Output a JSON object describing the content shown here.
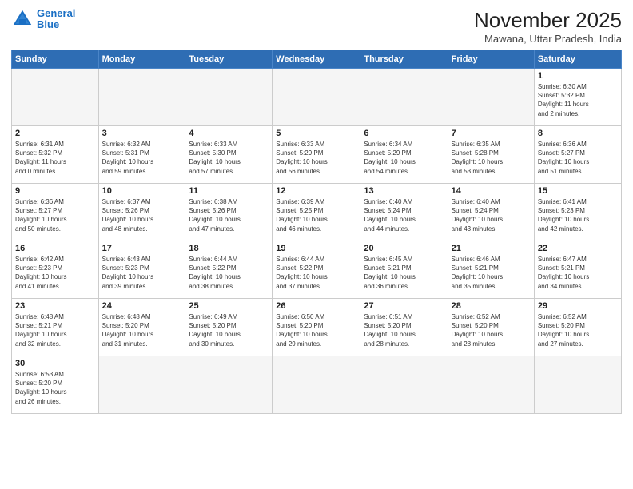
{
  "logo": {
    "line1": "General",
    "line2": "Blue"
  },
  "title": "November 2025",
  "subtitle": "Mawana, Uttar Pradesh, India",
  "weekdays": [
    "Sunday",
    "Monday",
    "Tuesday",
    "Wednesday",
    "Thursday",
    "Friday",
    "Saturday"
  ],
  "weeks": [
    [
      {
        "day": "",
        "info": ""
      },
      {
        "day": "",
        "info": ""
      },
      {
        "day": "",
        "info": ""
      },
      {
        "day": "",
        "info": ""
      },
      {
        "day": "",
        "info": ""
      },
      {
        "day": "",
        "info": ""
      },
      {
        "day": "1",
        "info": "Sunrise: 6:30 AM\nSunset: 5:32 PM\nDaylight: 11 hours\nand 2 minutes."
      }
    ],
    [
      {
        "day": "2",
        "info": "Sunrise: 6:31 AM\nSunset: 5:32 PM\nDaylight: 11 hours\nand 0 minutes."
      },
      {
        "day": "3",
        "info": "Sunrise: 6:32 AM\nSunset: 5:31 PM\nDaylight: 10 hours\nand 59 minutes."
      },
      {
        "day": "4",
        "info": "Sunrise: 6:33 AM\nSunset: 5:30 PM\nDaylight: 10 hours\nand 57 minutes."
      },
      {
        "day": "5",
        "info": "Sunrise: 6:33 AM\nSunset: 5:29 PM\nDaylight: 10 hours\nand 56 minutes."
      },
      {
        "day": "6",
        "info": "Sunrise: 6:34 AM\nSunset: 5:29 PM\nDaylight: 10 hours\nand 54 minutes."
      },
      {
        "day": "7",
        "info": "Sunrise: 6:35 AM\nSunset: 5:28 PM\nDaylight: 10 hours\nand 53 minutes."
      },
      {
        "day": "8",
        "info": "Sunrise: 6:36 AM\nSunset: 5:27 PM\nDaylight: 10 hours\nand 51 minutes."
      }
    ],
    [
      {
        "day": "9",
        "info": "Sunrise: 6:36 AM\nSunset: 5:27 PM\nDaylight: 10 hours\nand 50 minutes."
      },
      {
        "day": "10",
        "info": "Sunrise: 6:37 AM\nSunset: 5:26 PM\nDaylight: 10 hours\nand 48 minutes."
      },
      {
        "day": "11",
        "info": "Sunrise: 6:38 AM\nSunset: 5:26 PM\nDaylight: 10 hours\nand 47 minutes."
      },
      {
        "day": "12",
        "info": "Sunrise: 6:39 AM\nSunset: 5:25 PM\nDaylight: 10 hours\nand 46 minutes."
      },
      {
        "day": "13",
        "info": "Sunrise: 6:40 AM\nSunset: 5:24 PM\nDaylight: 10 hours\nand 44 minutes."
      },
      {
        "day": "14",
        "info": "Sunrise: 6:40 AM\nSunset: 5:24 PM\nDaylight: 10 hours\nand 43 minutes."
      },
      {
        "day": "15",
        "info": "Sunrise: 6:41 AM\nSunset: 5:23 PM\nDaylight: 10 hours\nand 42 minutes."
      }
    ],
    [
      {
        "day": "16",
        "info": "Sunrise: 6:42 AM\nSunset: 5:23 PM\nDaylight: 10 hours\nand 41 minutes."
      },
      {
        "day": "17",
        "info": "Sunrise: 6:43 AM\nSunset: 5:23 PM\nDaylight: 10 hours\nand 39 minutes."
      },
      {
        "day": "18",
        "info": "Sunrise: 6:44 AM\nSunset: 5:22 PM\nDaylight: 10 hours\nand 38 minutes."
      },
      {
        "day": "19",
        "info": "Sunrise: 6:44 AM\nSunset: 5:22 PM\nDaylight: 10 hours\nand 37 minutes."
      },
      {
        "day": "20",
        "info": "Sunrise: 6:45 AM\nSunset: 5:21 PM\nDaylight: 10 hours\nand 36 minutes."
      },
      {
        "day": "21",
        "info": "Sunrise: 6:46 AM\nSunset: 5:21 PM\nDaylight: 10 hours\nand 35 minutes."
      },
      {
        "day": "22",
        "info": "Sunrise: 6:47 AM\nSunset: 5:21 PM\nDaylight: 10 hours\nand 34 minutes."
      }
    ],
    [
      {
        "day": "23",
        "info": "Sunrise: 6:48 AM\nSunset: 5:21 PM\nDaylight: 10 hours\nand 32 minutes."
      },
      {
        "day": "24",
        "info": "Sunrise: 6:48 AM\nSunset: 5:20 PM\nDaylight: 10 hours\nand 31 minutes."
      },
      {
        "day": "25",
        "info": "Sunrise: 6:49 AM\nSunset: 5:20 PM\nDaylight: 10 hours\nand 30 minutes."
      },
      {
        "day": "26",
        "info": "Sunrise: 6:50 AM\nSunset: 5:20 PM\nDaylight: 10 hours\nand 29 minutes."
      },
      {
        "day": "27",
        "info": "Sunrise: 6:51 AM\nSunset: 5:20 PM\nDaylight: 10 hours\nand 28 minutes."
      },
      {
        "day": "28",
        "info": "Sunrise: 6:52 AM\nSunset: 5:20 PM\nDaylight: 10 hours\nand 28 minutes."
      },
      {
        "day": "29",
        "info": "Sunrise: 6:52 AM\nSunset: 5:20 PM\nDaylight: 10 hours\nand 27 minutes."
      }
    ],
    [
      {
        "day": "30",
        "info": "Sunrise: 6:53 AM\nSunset: 5:20 PM\nDaylight: 10 hours\nand 26 minutes."
      },
      {
        "day": "",
        "info": ""
      },
      {
        "day": "",
        "info": ""
      },
      {
        "day": "",
        "info": ""
      },
      {
        "day": "",
        "info": ""
      },
      {
        "day": "",
        "info": ""
      },
      {
        "day": "",
        "info": ""
      }
    ]
  ]
}
